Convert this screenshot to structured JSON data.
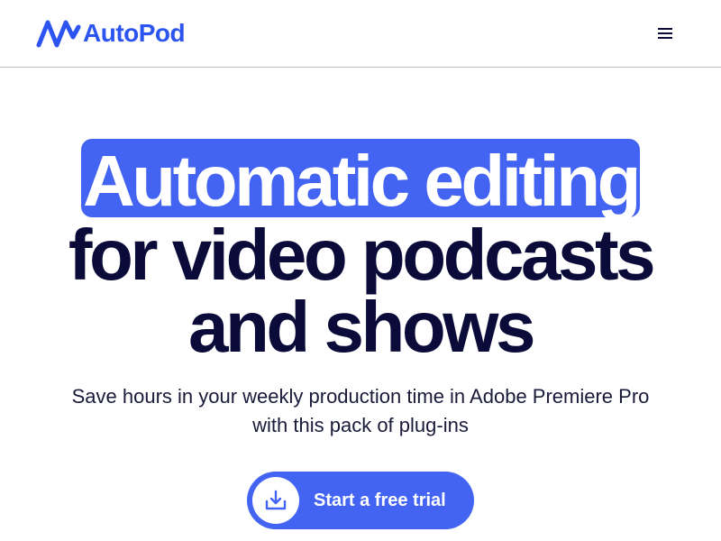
{
  "header": {
    "logo_text": "AutoPod",
    "logo_icon": "autopod-waveform-icon",
    "menu_icon": "hamburger-menu-icon"
  },
  "hero": {
    "headline_line1": "Automatic editing",
    "headline_line2": "for video podcasts",
    "headline_line3": "and shows",
    "subtitle_line1": "Save hours in your weekly production time in Adobe Premiere Pro",
    "subtitle_line2": "with this pack of plug-ins",
    "cta_label": "Start a free trial",
    "cta_icon": "download-icon"
  },
  "colors": {
    "brand_blue": "#2b54f0",
    "highlight_blue": "#4363f2",
    "heading_navy": "#0b0b3a",
    "background": "#ffffff"
  }
}
